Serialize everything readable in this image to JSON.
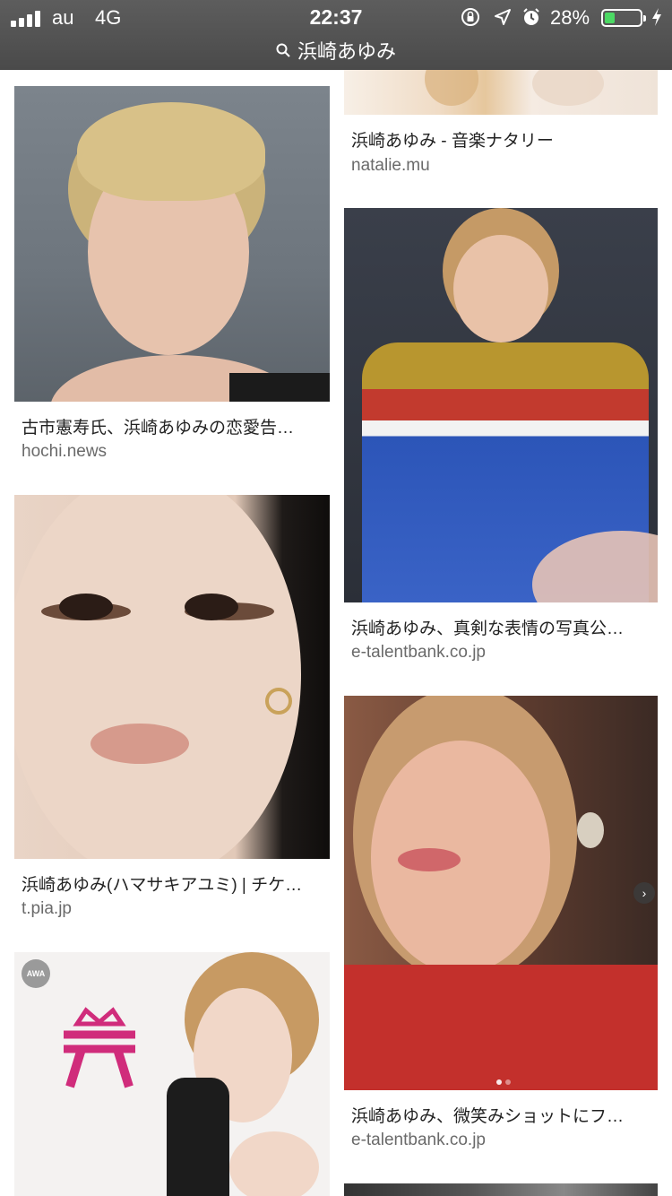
{
  "status_bar": {
    "carrier": "au",
    "network": "4G",
    "time": "22:37",
    "battery_percent": "28%",
    "battery_level": 0.28,
    "icons": [
      "signal-icon",
      "orientation-lock-icon",
      "location-arrow-icon",
      "alarm-icon",
      "battery-icon",
      "charging-icon"
    ]
  },
  "search": {
    "icon": "search-icon",
    "query": "浜崎あゆみ"
  },
  "results": [
    {
      "caption": "浜崎あゆみ - 音楽ナタリー",
      "source": "natalie.mu"
    },
    {
      "caption": "古市憲寿氏、浜崎あゆみの恋愛告…",
      "source": "hochi.news"
    },
    {
      "caption": "浜崎あゆみ、真剣な表情の写真公…",
      "source": "e-talentbank.co.jp"
    },
    {
      "caption": "浜崎あゆみ(ハマサキアユミ) | チケ…",
      "source": "t.pia.jp"
    },
    {
      "caption": "浜崎あゆみ、微笑みショットにフ…",
      "source": "e-talentbank.co.jp"
    },
    {
      "caption": "",
      "source": "",
      "badge": "AWA"
    }
  ],
  "colors": {
    "topbar": "#4f4f4f",
    "battery_fill": "#4cd964",
    "caption_text": "#222222",
    "source_text": "#6a6a6a"
  }
}
